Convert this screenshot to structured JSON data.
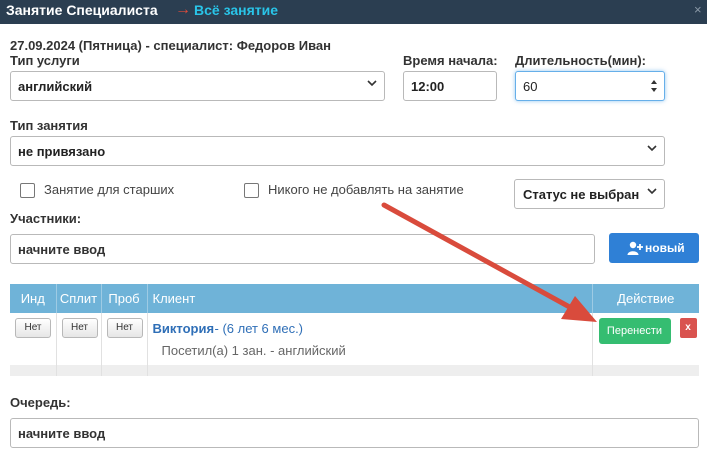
{
  "titlebar": {
    "title": "Занятие Специалиста",
    "arrow": "→",
    "link": "Всё занятие",
    "close": "×"
  },
  "header": {
    "date_line": "27.09.2024 (Пятница) - специалист: Федоров Иван"
  },
  "form": {
    "service_type_label": "Тип услуги",
    "service_type_value": "английский",
    "start_time_label": "Время начала:",
    "start_time_value": "12:00",
    "duration_label": "Длительность(мин):",
    "duration_value": "60",
    "lesson_type_label": "Тип занятия",
    "lesson_type_value": "не привязано",
    "senior_checkbox_label": "Занятие для старших",
    "senior_checked": false,
    "no_add_checkbox_label": "Никого не добавлять на занятие",
    "no_add_checked": false,
    "status_value": "Статус не выбран",
    "participants_label": "Участники:",
    "participants_placeholder": "начните ввод",
    "new_button_label": "новый",
    "queue_label": "Очередь:",
    "queue_placeholder": "начните ввод"
  },
  "table": {
    "headers": [
      "Инд",
      "Сплит",
      "Проб",
      "Клиент",
      "Действие"
    ],
    "rows": [
      {
        "ind": "Нет",
        "split": "Нет",
        "prob": "Нет",
        "client_name": "Виктория",
        "client_age": "- (6 лет 6 мес.)",
        "client_info": "Посетил(а) 1 зан. - английский",
        "move_button": "Перенести",
        "delete_button": "x"
      }
    ]
  },
  "colors": {
    "titlebar_bg": "#2b3e51",
    "link": "#29c4e8",
    "header_bg": "#6fb3d8",
    "primary_button": "#2f80d6",
    "move_button": "#35bd71",
    "delete_button": "#d9534f",
    "annotation_arrow": "#d94b3c"
  }
}
